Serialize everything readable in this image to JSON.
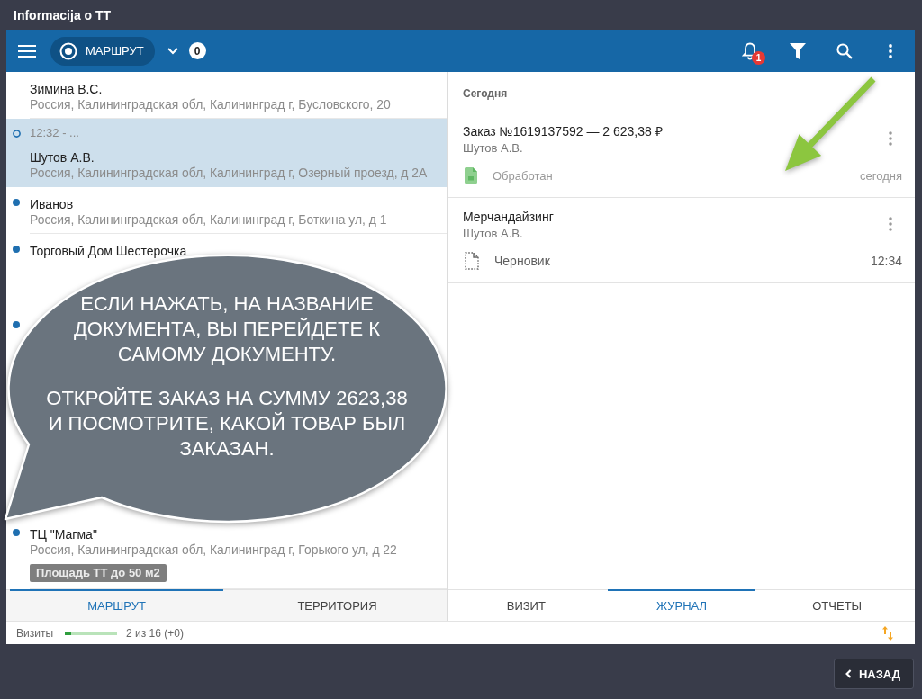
{
  "window": {
    "title": "Informacija o TT"
  },
  "app_bar": {
    "route_button": {
      "label": "МАРШРУТ"
    },
    "route_count": "0",
    "notifications": "1"
  },
  "route_list": {
    "items": [
      {
        "name": "Зимина В.С.",
        "address": "Россия, Калининградская обл, Калининград г, Бусловского, 20",
        "planned": false,
        "current": false,
        "selected": false
      },
      {
        "time": "12:32 - ...",
        "name": "Шутов А.В.",
        "address": "Россия, Калининградская обл, Калининград г, Озерный проезд, д 2А",
        "planned": false,
        "current": true,
        "selected": true
      },
      {
        "name": "Иванов",
        "address": "Россия, Калининградская обл, Калининград г, Боткина ул, д 1",
        "planned": true,
        "current": false,
        "selected": false
      },
      {
        "name": "Торговый Дом Шестерочка",
        "planned": true,
        "current": false,
        "selected": false
      },
      {
        "planned": true,
        "current": false,
        "selected": false
      },
      {
        "name": "ТЦ \"Магма\"",
        "address": "Россия, Калининградская обл, Калининград г, Горького ул, д 22",
        "tags": [
          "Площадь ТТ до 50 м2"
        ],
        "planned": true,
        "current": false,
        "selected": false
      }
    ]
  },
  "left_tabs": [
    {
      "label": "МАРШРУТ",
      "selected": true
    },
    {
      "label": "ТЕРРИТОРИЯ",
      "selected": false
    }
  ],
  "journal": {
    "section": "Сегодня",
    "entries": [
      {
        "title": "Заказ №1619137592 — 2 623,38 ₽",
        "author": "Шутов А.В.",
        "status": {
          "kind": "processed",
          "label": "Обработан"
        },
        "time": "сегодня"
      },
      {
        "title": "Мерчандайзинг",
        "author": "Шутов А.В.",
        "status": {
          "kind": "draft",
          "label": "Черновик"
        },
        "time": "12:34"
      }
    ]
  },
  "right_tabs": [
    {
      "label": "ВИЗИТ",
      "selected": false
    },
    {
      "label": "ЖУРНАЛ",
      "selected": true
    },
    {
      "label": "ОТЧЕТЫ",
      "selected": false
    }
  ],
  "status_bar": {
    "label": "Визиты",
    "progress": {
      "level": 0.125
    },
    "reading": "2 из 16 (+0)"
  },
  "tip": {
    "paragraphs": [
      "ЕСЛИ НАЖАТЬ, НА НАЗВАНИЕ\nДОКУМЕНТА, ВЫ ПЕРЕЙДЕТЕ К\nСАМОМУ ДОКУМЕНТУ.",
      "ОТКРОЙТЕ ЗАКАЗ НА СУММУ 2623,38\nИ ПОСМОТРИТЕ, КАКОЙ ТОВАР БЫЛ\nЗАКАЗАН."
    ]
  },
  "back_button": {
    "label": "НАЗАД"
  }
}
